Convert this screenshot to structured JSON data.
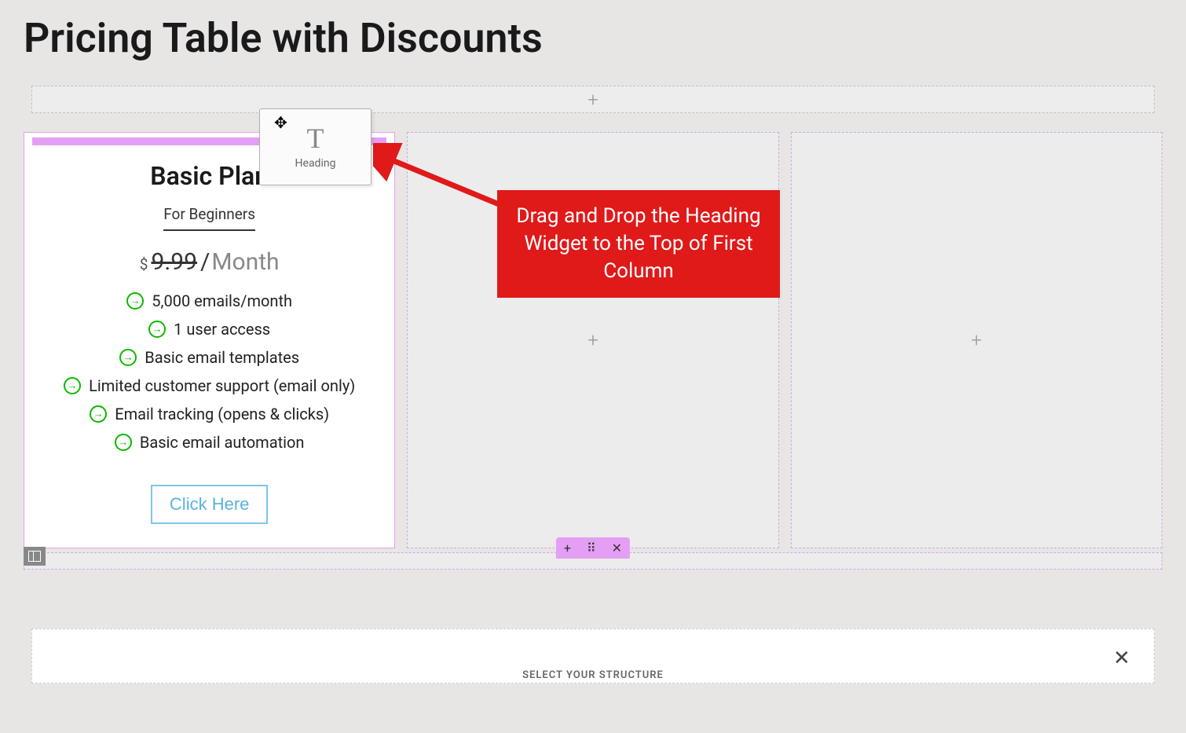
{
  "page": {
    "title": "Pricing Table with Discounts"
  },
  "card": {
    "name": "Basic Plan",
    "subtitle": "For Beginners",
    "currency": "$",
    "price": "9.99",
    "separator": "/",
    "period": "Month",
    "features": [
      "5,000 emails/month",
      "1 user access",
      "Basic email templates",
      "Limited customer support (email only)",
      "Email tracking (opens & clicks)",
      "Basic email automation"
    ],
    "cta": "Click Here"
  },
  "widget": {
    "label": "Heading"
  },
  "annotation": {
    "text": "Drag and Drop the Heading Widget to the Top of First Column"
  },
  "controls": {
    "add": "+",
    "drag": "⠿",
    "close": "✕"
  },
  "structure": {
    "label": "SELECT YOUR STRUCTURE",
    "close": "✕"
  }
}
